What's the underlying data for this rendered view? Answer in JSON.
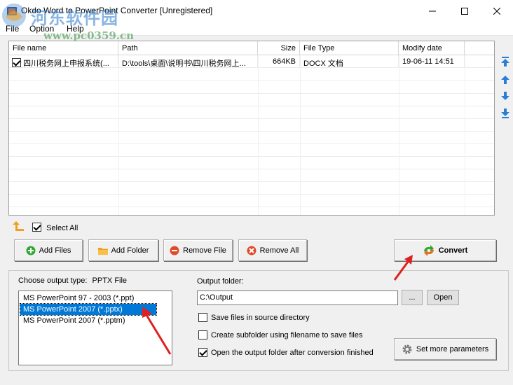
{
  "window": {
    "title": "Okdo Word to PowerPoint Converter [Unregistered]",
    "watermark": "河东软件园",
    "watermark_url": "www.pc0359.cn"
  },
  "menu": [
    "File",
    "Option",
    "Help"
  ],
  "file_list": {
    "columns": [
      "File name",
      "Path",
      "Size",
      "File Type",
      "Modify date"
    ],
    "rows": [
      {
        "checked": true,
        "name": "四川税务网上申报系统(...",
        "path": "D:\\tools\\桌面\\说明书\\四川税务网上...",
        "size": "664KB",
        "type": "DOCX 文档",
        "date": "19-06-11 14:51"
      }
    ]
  },
  "select_all": {
    "label": "Select All",
    "checked": true
  },
  "buttons": {
    "add_files": "Add Files",
    "add_folder": "Add Folder",
    "remove_file": "Remove File",
    "remove_all": "Remove All",
    "convert": "Convert"
  },
  "output_type": {
    "label": "Choose output type:",
    "value": "PPTX File",
    "options": [
      "MS PowerPoint 97 - 2003 (*.ppt)",
      "MS PowerPoint 2007 (*.pptx)",
      "MS PowerPoint 2007 (*.pptm)"
    ],
    "selected_index": 1
  },
  "output_folder": {
    "label": "Output folder:",
    "value": "C:\\Output",
    "browse": "...",
    "open": "Open"
  },
  "options": {
    "save_in_source": {
      "label": "Save files in source directory",
      "checked": false
    },
    "create_subfolder": {
      "label": "Create subfolder using filename to save files",
      "checked": false
    },
    "open_after": {
      "label": "Open the output folder after conversion finished",
      "checked": true
    },
    "more_params": "Set more parameters"
  },
  "colors": {
    "accent_blue": "#0078d7",
    "arrow_red": "#e02020",
    "icon_blue": "#2a7fd4",
    "icon_orange": "#f0a020"
  }
}
